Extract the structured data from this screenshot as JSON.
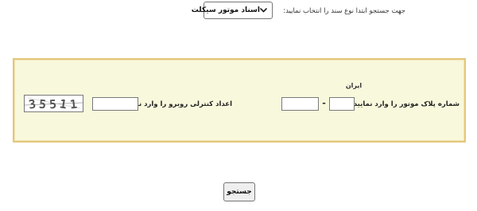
{
  "header": {
    "prompt_text": "جهت جستجو ابتدا نوع سند را انتخاب نمایید:",
    "document_type_select": {
      "selected_value": "اسناد موتور سیکلت"
    }
  },
  "form": {
    "plate": {
      "label": "شماره پلاک موتور را وارد نمایید:",
      "iran_label": "ایران",
      "separator": "-",
      "part1_value": "",
      "part2_value": ""
    },
    "captcha": {
      "label": "اعداد کنترلی روبرو را وارد نمایید:",
      "input_value": "",
      "image_code": "35511"
    }
  },
  "actions": {
    "search_label": "جستجو"
  },
  "colors": {
    "panel_background": "#f8f8dc",
    "panel_border": "#e3c77a"
  },
  "icons": {
    "select_arrow": "chevron-down-icon"
  }
}
